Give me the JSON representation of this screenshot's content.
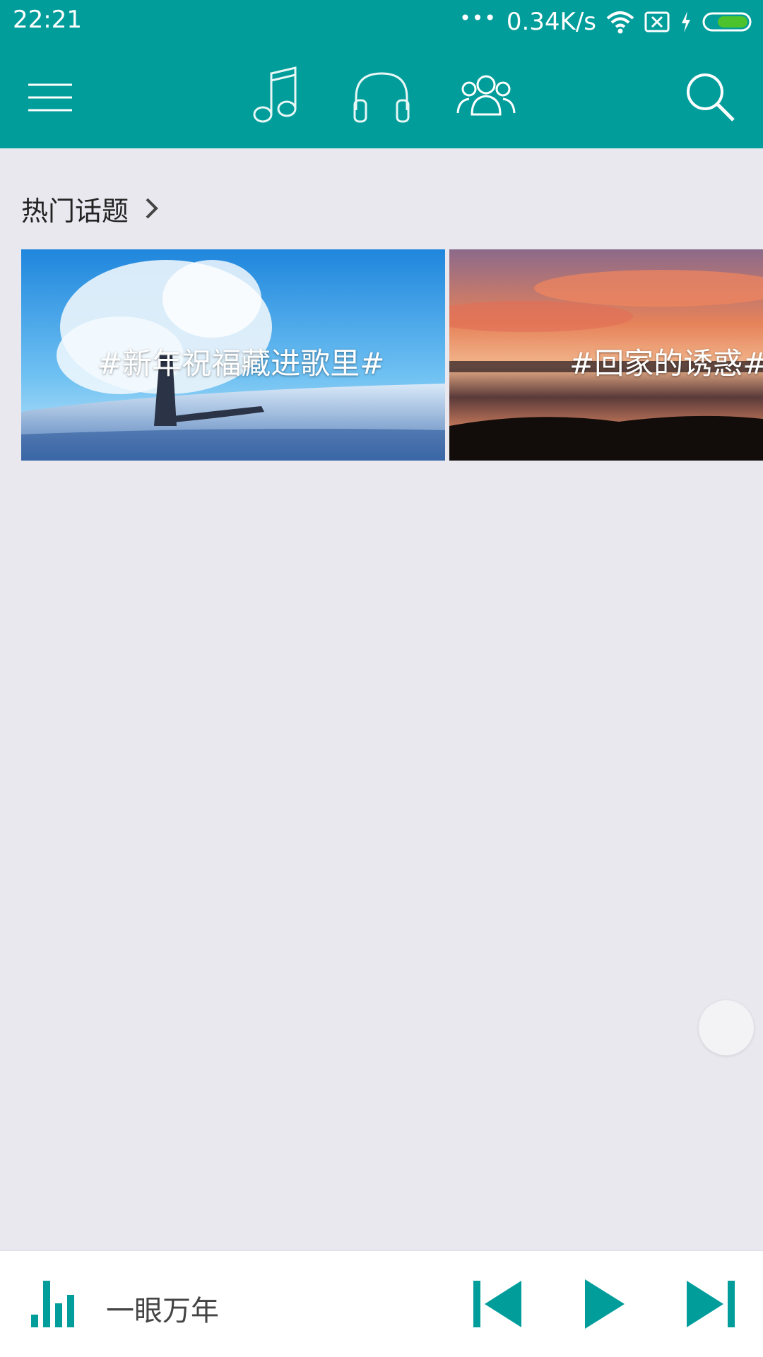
{
  "status_bar": {
    "time": "22:21",
    "dots": "•••",
    "network_speed": "0.34K/s",
    "battery_color": "#4cc22d"
  },
  "colors": {
    "primary": "#009d9a",
    "background": "#e9e8ef"
  },
  "app_bar": {
    "icons": [
      "menu-icon",
      "music-note-icon",
      "headphones-icon",
      "friends-icon",
      "search-icon"
    ]
  },
  "hot_topics": {
    "title": "热门话题",
    "items": [
      {
        "label": "#新年祝福藏进歌里#"
      },
      {
        "label": "#回家的诱惑#"
      }
    ]
  },
  "player": {
    "song_title": "一眼万年"
  }
}
